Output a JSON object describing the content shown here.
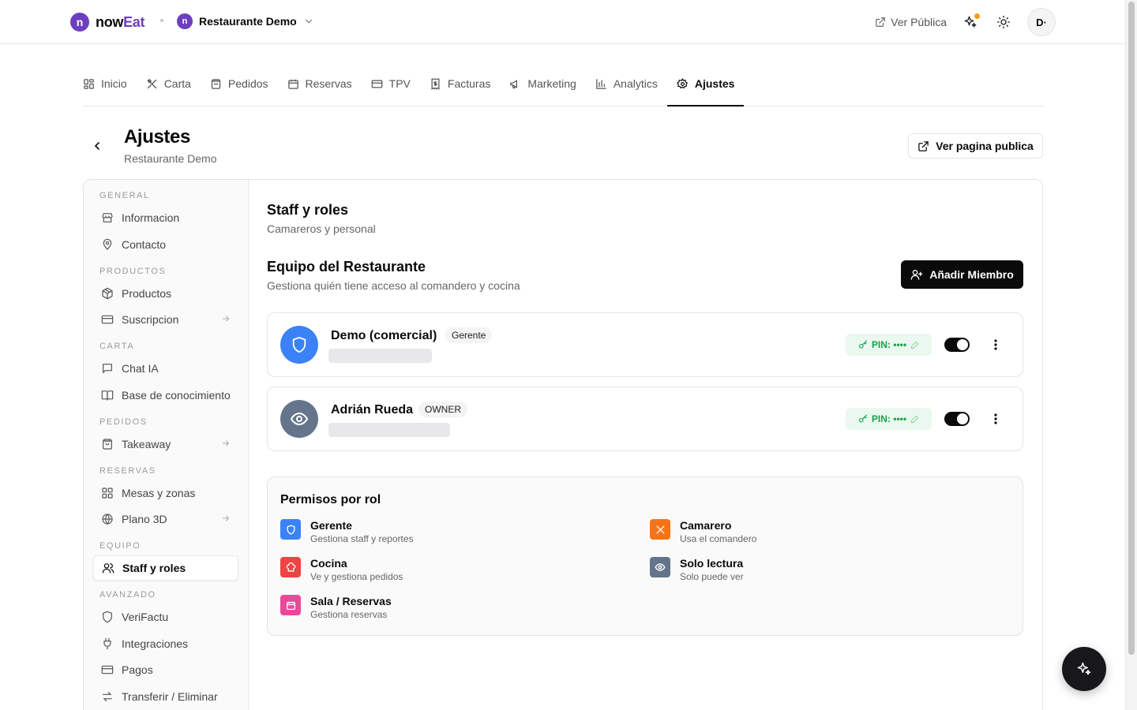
{
  "brand": {
    "logo_letter": "n",
    "name_part1": "now",
    "name_part2": "Eat",
    "accent": "#6d3fc0"
  },
  "restaurant_switch": {
    "letter": "n",
    "name": "Restaurante Demo"
  },
  "topbar": {
    "ver_publica": "Ver Pública",
    "avatar_initials": "D·",
    "notification_color": "#f59e0b"
  },
  "tabs": [
    {
      "label": "Inicio",
      "icon": "grid-icon"
    },
    {
      "label": "Carta",
      "icon": "utensils-icon"
    },
    {
      "label": "Pedidos",
      "icon": "bag-icon"
    },
    {
      "label": "Reservas",
      "icon": "calendar-icon"
    },
    {
      "label": "TPV",
      "icon": "card-icon"
    },
    {
      "label": "Facturas",
      "icon": "receipt-icon"
    },
    {
      "label": "Marketing",
      "icon": "megaphone-icon"
    },
    {
      "label": "Analytics",
      "icon": "bar-chart-icon"
    },
    {
      "label": "Ajustes",
      "icon": "gear-icon",
      "active": true
    }
  ],
  "page": {
    "title": "Ajustes",
    "subtitle": "Restaurante Demo",
    "public_button": "Ver pagina publica"
  },
  "sidebar": {
    "groups": [
      {
        "label": "GENERAL",
        "items": [
          {
            "label": "Informacion",
            "icon": "store-icon"
          },
          {
            "label": "Contacto",
            "icon": "map-pin-icon"
          }
        ]
      },
      {
        "label": "PRODUCTOS",
        "items": [
          {
            "label": "Productos",
            "icon": "package-icon"
          },
          {
            "label": "Suscripcion",
            "icon": "card-icon",
            "arrow": true
          }
        ]
      },
      {
        "label": "CARTA",
        "items": [
          {
            "label": "Chat IA",
            "icon": "chat-icon"
          },
          {
            "label": "Base de conocimiento",
            "icon": "book-icon"
          }
        ]
      },
      {
        "label": "PEDIDOS",
        "items": [
          {
            "label": "Takeaway",
            "icon": "bag-icon",
            "arrow": true
          }
        ]
      },
      {
        "label": "RESERVAS",
        "items": [
          {
            "label": "Mesas y zonas",
            "icon": "grid-icon"
          },
          {
            "label": "Plano 3D",
            "icon": "globe-icon",
            "arrow": true
          }
        ]
      },
      {
        "label": "EQUIPO",
        "items": [
          {
            "label": "Staff y roles",
            "icon": "users-icon",
            "active": true
          }
        ]
      },
      {
        "label": "AVANZADO",
        "items": [
          {
            "label": "VeriFactu",
            "icon": "shield-icon"
          },
          {
            "label": "Integraciones",
            "icon": "plug-icon"
          },
          {
            "label": "Pagos",
            "icon": "card-icon"
          },
          {
            "label": "Transferir / Eliminar",
            "icon": "transfer-icon"
          }
        ]
      }
    ]
  },
  "section": {
    "title": "Staff y roles",
    "subtitle": "Camareros y personal"
  },
  "team": {
    "title": "Equipo del Restaurante",
    "subtitle": "Gestiona quién tiene acceso al comandero y cocina",
    "add_button": "Añadir Miembro"
  },
  "members": [
    {
      "name": "Demo (comercial)",
      "role": "Gerente",
      "pin": "PIN: ••••",
      "avatar_icon": "shield-icon",
      "avatar_color": "#3b82f6",
      "active": true
    },
    {
      "name": "Adrián Rueda",
      "role": "OWNER",
      "pin": "PIN: ••••",
      "avatar_icon": "eye-icon",
      "avatar_color": "#64748b",
      "active": true
    }
  ],
  "permissions": {
    "title": "Permisos por rol",
    "roles": [
      {
        "name": "Gerente",
        "desc": "Gestiona staff y reportes",
        "icon": "shield-icon",
        "color": "#3b82f6"
      },
      {
        "name": "Camarero",
        "desc": "Usa el comandero",
        "icon": "utensils-icon",
        "color": "#f97316"
      },
      {
        "name": "Cocina",
        "desc": "Ve y gestiona pedidos",
        "icon": "chef-hat-icon",
        "color": "#ef4444"
      },
      {
        "name": "Solo lectura",
        "desc": "Solo puede ver",
        "icon": "eye-icon",
        "color": "#64748b"
      },
      {
        "name": "Sala / Reservas",
        "desc": "Gestiona reservas",
        "icon": "calendar-icon",
        "color": "#ec4899"
      }
    ]
  }
}
